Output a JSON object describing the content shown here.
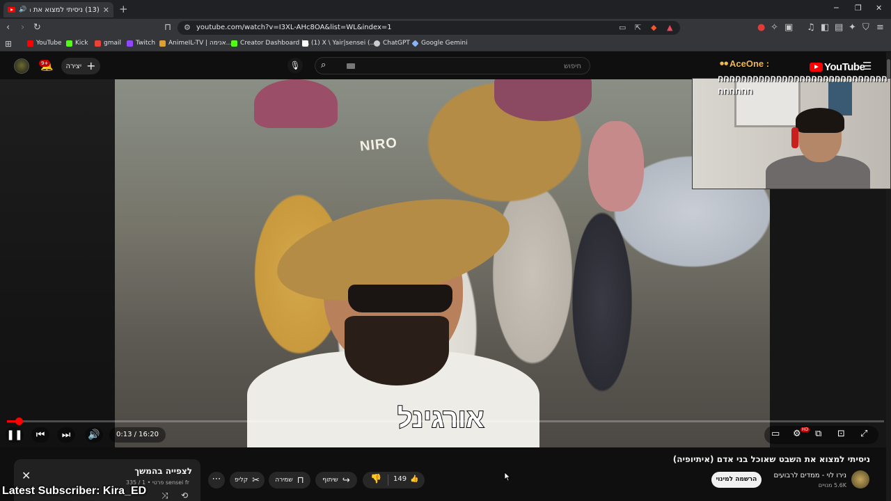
{
  "browser": {
    "tab_title": "(13) ניסיתי למצוא את השבט",
    "tab_close": "✕",
    "new_tab": "+",
    "url": "youtube.com/watch?v=I3XL-AHc8OA&list=WL&index=1",
    "window_controls": [
      "─",
      "❐",
      "✕"
    ],
    "bookmarks": [
      {
        "label": "YouTube",
        "color": "#ff0000"
      },
      {
        "label": "Kick",
        "color": "#53fc18"
      },
      {
        "label": "gmail",
        "color": "#ea4335"
      },
      {
        "label": "Twitch",
        "color": "#9146ff"
      },
      {
        "label": "AnimeIL-TV | אנימה...",
        "color": "#e0a030"
      },
      {
        "label": "Creator Dashboard |...",
        "color": "#53fc18"
      },
      {
        "label": "(1) X \\ Yair|sensei (...",
        "color": "#ffffff"
      },
      {
        "label": "ChatGPT",
        "color": "#cccccc"
      },
      {
        "label": "Google Gemini",
        "color": "#8ab4f8"
      }
    ]
  },
  "youtube": {
    "create_label": "יצירה",
    "notification_count": "9+",
    "search_placeholder": "חיפוש",
    "logo_text": "YouTube"
  },
  "chat": {
    "username": "AceOne :",
    "message": "חחחחחחחחחחחחחחחחחחחחחחחחחחחחחחחחחחח"
  },
  "player": {
    "subtitle": "אורגינל",
    "hat_text": "NIRO",
    "current_time": "0:13",
    "duration": "16:20",
    "time_display": "0:13 / 16:20",
    "progress_fraction": 0.0133,
    "hd_badge": "HD"
  },
  "video": {
    "title": "ניסיתי למצוא את השבט שאוכל בני אדם (איתיופיה)",
    "channel_name": "נירו לוי - ממדים לרבועים",
    "subscribers": "5.6K מנויים",
    "subscribe_label": "הרשמה למינוי",
    "like_count": "149",
    "share_label": "שיתוף",
    "save_label": "שמירה",
    "clip_label": "קליפ",
    "more_label": "⋯"
  },
  "queue": {
    "title": "לצפייה בהמשך",
    "subtitle": "sensei fr פרטי  •  1 / 335"
  },
  "overlay": {
    "latest_subscriber": "Latest Subscriber: Kira_ED"
  },
  "colors": {
    "accent": "#ff0000",
    "background": "#0f0f0f",
    "chat_name": "#f2b84b"
  }
}
